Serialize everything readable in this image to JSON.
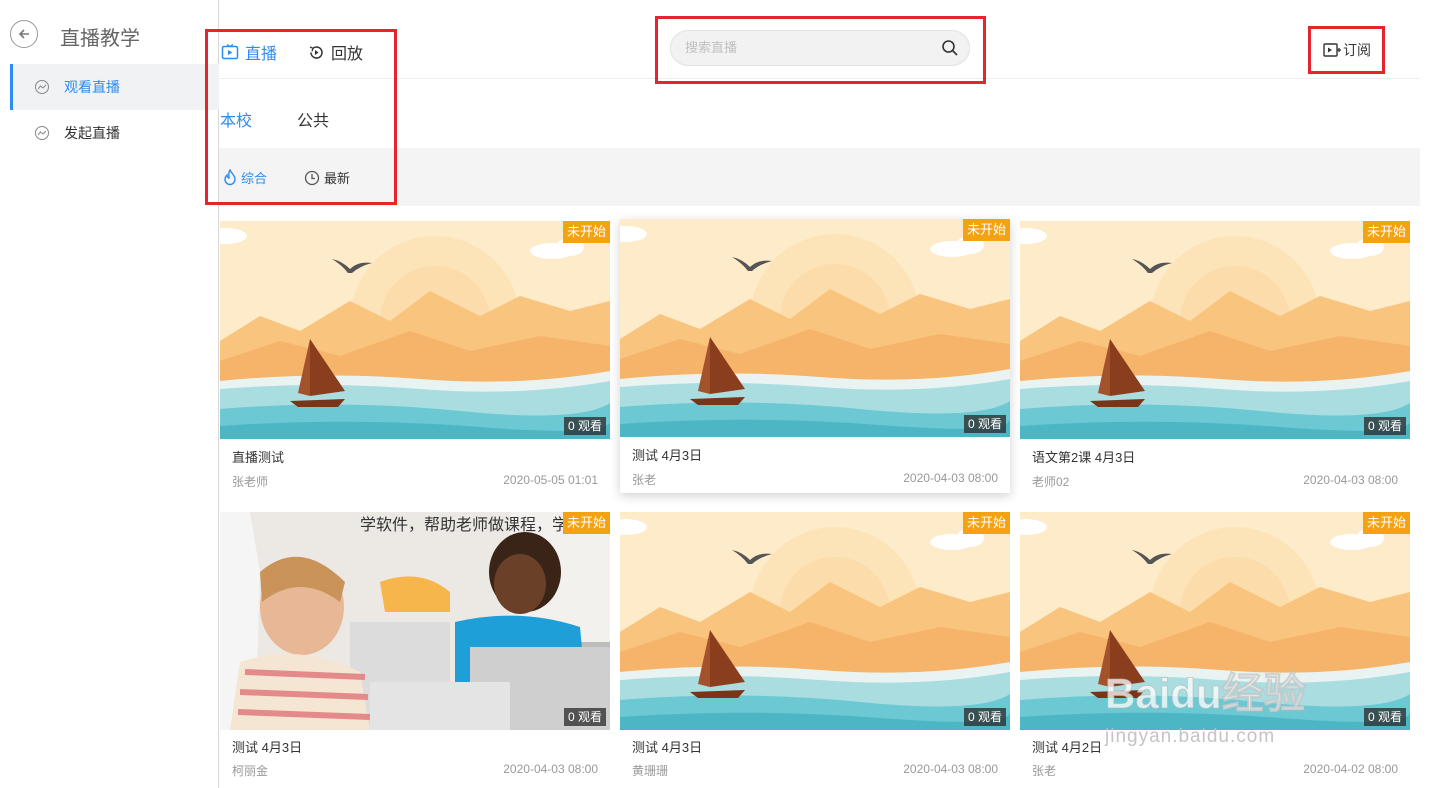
{
  "app": {
    "title": "直播教学"
  },
  "sidebar": {
    "items": [
      {
        "label": "观看直播",
        "active": true
      },
      {
        "label": "发起直播",
        "active": false
      }
    ]
  },
  "header": {
    "tabs": [
      {
        "label": "直播",
        "icon": "live-tv-icon",
        "active": true
      },
      {
        "label": "回放",
        "icon": "replay-icon",
        "active": false
      }
    ],
    "search": {
      "placeholder": "搜索直播",
      "value": ""
    },
    "subscribe_label": "订阅"
  },
  "scope_tabs": [
    {
      "label": "本校",
      "active": true
    },
    {
      "label": "公共",
      "active": false
    }
  ],
  "sort_tabs": [
    {
      "label": "综合",
      "icon": "flame-icon",
      "active": true
    },
    {
      "label": "最新",
      "icon": "clock-icon",
      "active": false
    }
  ],
  "cards": [
    {
      "title": "直播测试",
      "teacher": "张老师",
      "date": "2020-05-05 01:01",
      "status": "未开始",
      "views": "0 观看"
    },
    {
      "title": "测试 4月3日",
      "teacher": "张老",
      "date": "2020-04-03 08:00",
      "status": "未开始",
      "views": "0 观看"
    },
    {
      "title": "语文第2课 4月3日",
      "teacher": "老师02",
      "date": "2020-04-03 08:00",
      "status": "未开始",
      "views": "0 观看"
    },
    {
      "title": "测试 4月3日",
      "teacher": "柯丽金",
      "date": "2020-04-03 08:00",
      "status": "未开始",
      "views": "0 观看"
    },
    {
      "title": "测试 4月3日",
      "teacher": "黄珊珊",
      "date": "2020-04-03 08:00",
      "status": "未开始",
      "views": "0 观看"
    },
    {
      "title": "测试 4月2日",
      "teacher": "张老",
      "date": "2020-04-02 08:00",
      "status": "未开始",
      "views": "0 观看"
    }
  ],
  "photo_caption": "学软件，帮助老师做课程，学生学得更多教",
  "watermark": {
    "brand": "Baidu经验",
    "url": "jingyan.baidu.com"
  },
  "colors": {
    "accent": "#2d8cf0",
    "badge": "#f3a212",
    "highlight": "#e5242b"
  }
}
